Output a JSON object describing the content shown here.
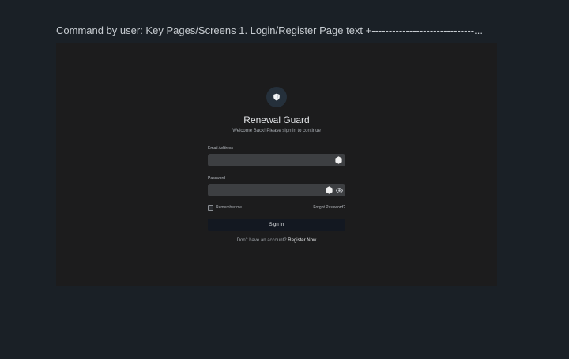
{
  "command": {
    "text": "Command by user: Key Pages/Screens 1. Login/Register Page text +------------------------------..."
  },
  "app": {
    "title": "Renewal Guard",
    "subtitle": "Welcome Back! Please sign in to continue"
  },
  "form": {
    "email": {
      "label": "Email Address",
      "value": "",
      "placeholder": ""
    },
    "password": {
      "label": "Password",
      "value": "",
      "placeholder": ""
    },
    "remember_label": "Remember me",
    "forgot_label": "Forgot Password?",
    "submit_label": "Sign In",
    "register_prompt": "Don't have an account?",
    "register_link": "Register Now"
  },
  "icons": {
    "logo": "shield-icon",
    "email_field_icon": "hexagon-icon",
    "password_field_icon": "hexagon-icon",
    "password_toggle": "eye-icon"
  },
  "colors": {
    "page_bg": "#1a2026",
    "frame_bg": "#1c1c1d",
    "field_bg": "#3d3f42",
    "button_bg": "#131821",
    "logo_bg": "#25303b"
  }
}
